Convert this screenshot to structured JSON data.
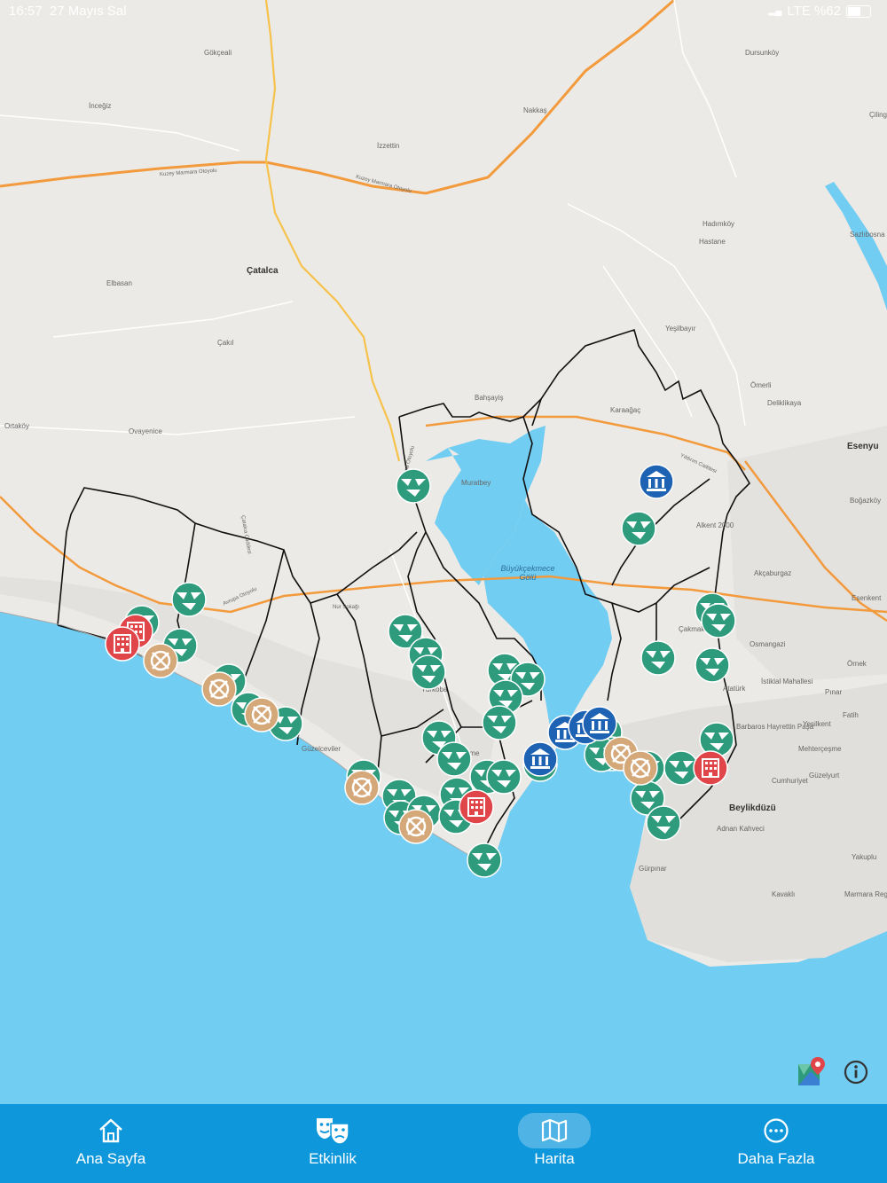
{
  "status_bar": {
    "time": "16:57",
    "date": "27 Mayıs Sal",
    "network": "LTE %62"
  },
  "map": {
    "labels": [
      "Gökçeali",
      "İnceğiz",
      "Nakkaş",
      "İzzettin",
      "Dursunköy",
      "Çiling",
      "Çatalca",
      "Elbasan",
      "Sazlıbosna",
      "Hadımköy",
      "Hastane",
      "Yeşilbayır",
      "Çakıl",
      "Bahşayiş",
      "Ortaköy",
      "Ovayenice",
      "Karaağaç",
      "Ömerli",
      "Deliklikaya",
      "Muratbey",
      "Alkent 2000",
      "Esenyu",
      "Boğazköy",
      "Akçaburgaz",
      "Esenkent",
      "Çakmaklı",
      "Osmangazi",
      "Atatürk",
      "İstiklal Mahallesi",
      "Pınar",
      "Örnek",
      "Barbaros Hayrettin Paşa",
      "Yesilkent",
      "Mehterçeşme",
      "Cumhuriyet",
      "Güzelyurt",
      "Fatih",
      "Beylikdüzü",
      "Adnan Kahveci",
      "Gürpınar",
      "Yakuplu",
      "Kavaklı",
      "Marmara Region",
      "Türkoba",
      "Esme",
      "Güzelceviler"
    ],
    "lake_label": "Büyükçekmece Gölü",
    "road_labels": [
      "Kuzey Marmara Otoyolu",
      "Kuzey Marmara Otoyolu",
      "Avrupa Otoyolu",
      "Yıldırım Caddesi",
      "Çatalca Caddesi",
      "Nur Sokağı",
      "Avrupa Otoyolu"
    ],
    "highlight_place": "Beylikdüzü"
  },
  "markers": {
    "park_count_note": "",
    "types": [
      "park-icon",
      "museum-icon",
      "hotel-icon",
      "restricted-icon"
    ]
  },
  "controls": {
    "layers_icon": "map-layers-icon",
    "info_icon": "info-icon"
  },
  "tabs": [
    {
      "label": "Ana Sayfa",
      "icon": "home-icon",
      "active": false
    },
    {
      "label": "Etkinlik",
      "icon": "theater-masks-icon",
      "active": false
    },
    {
      "label": "Harita",
      "icon": "map-icon",
      "active": true
    },
    {
      "label": "Daha Fazla",
      "icon": "more-icon",
      "active": false
    }
  ],
  "colors": {
    "sea": "#72cdf2",
    "land": "#eceae6",
    "tabbar": "#0e97db",
    "park": "#2e9b7c",
    "museum": "#1e62b3",
    "hotel": "#e0454a",
    "restricted": "#d4a878",
    "motorway": "#f29a3c"
  }
}
